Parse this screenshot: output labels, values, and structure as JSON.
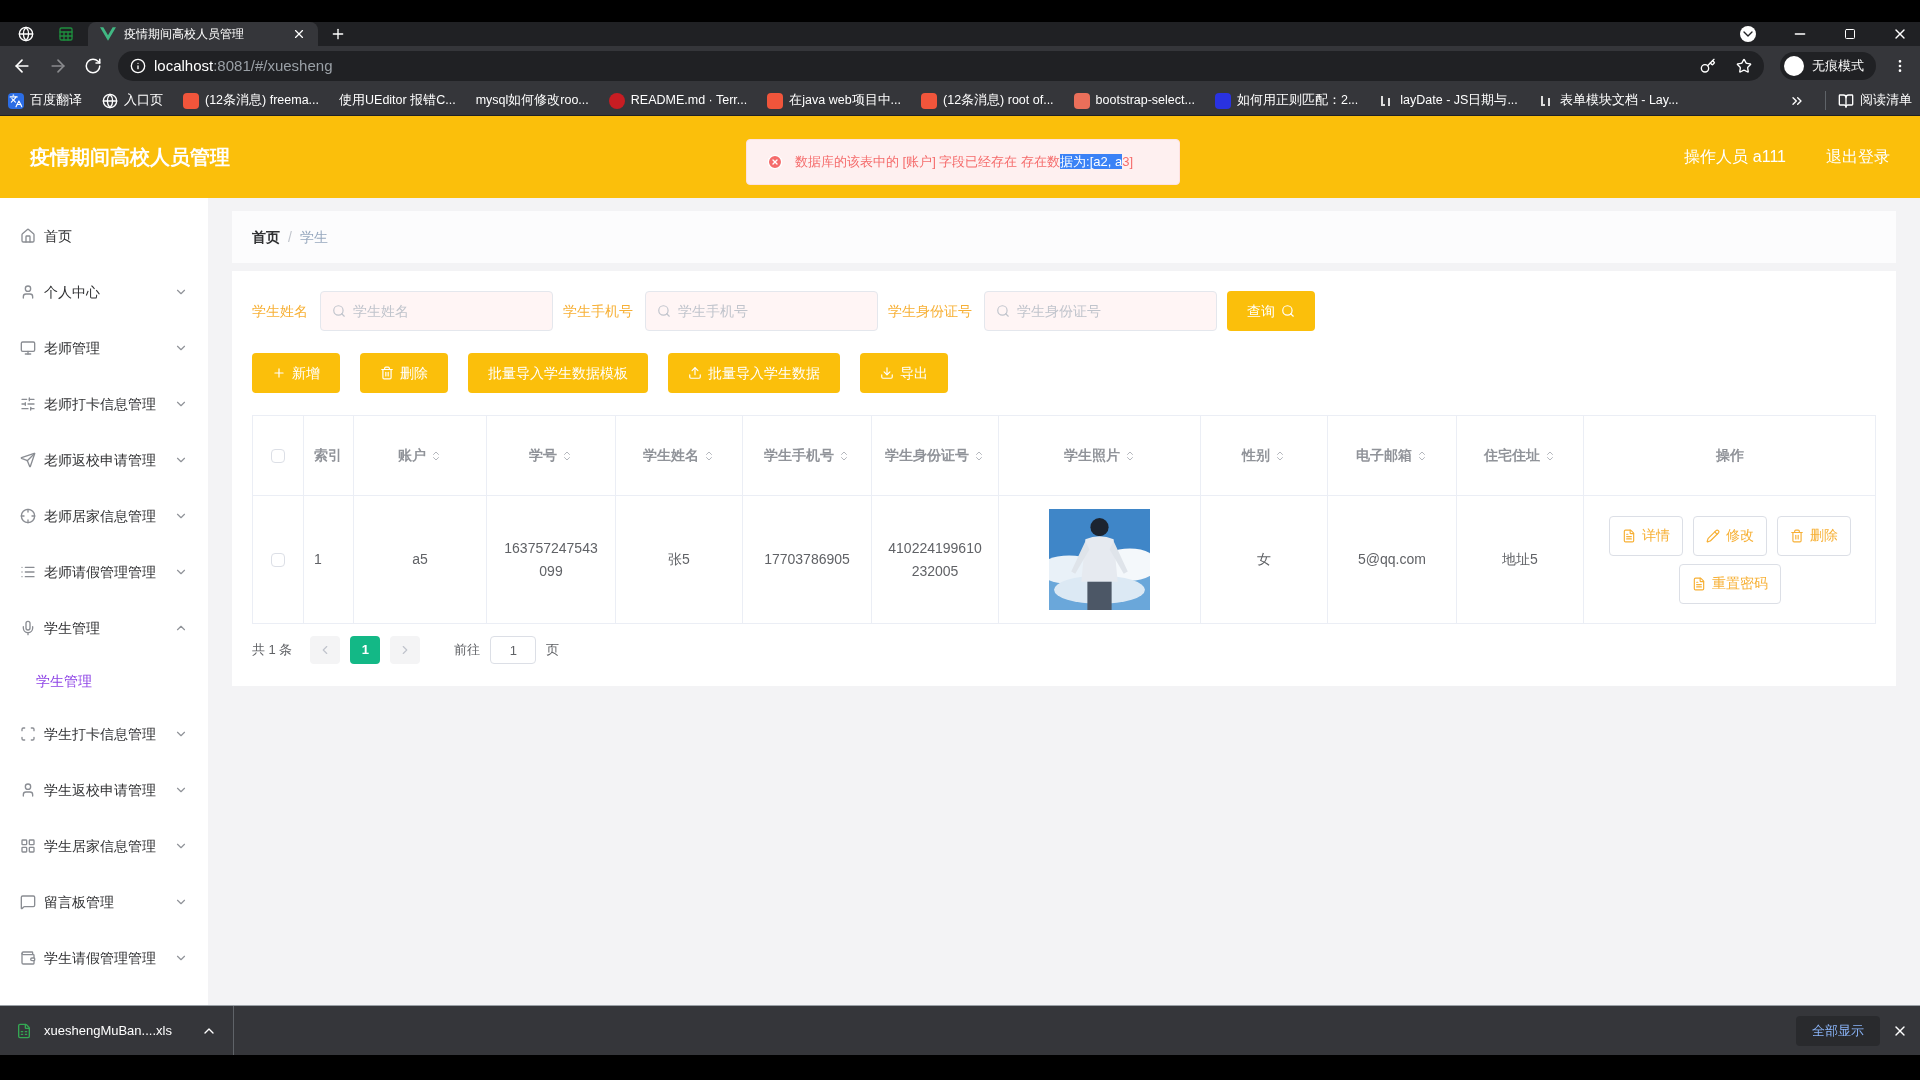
{
  "browser": {
    "tabs": [
      {
        "kind": "globe",
        "selected": false
      },
      {
        "kind": "sheet",
        "selected": false
      },
      {
        "kind": "vue",
        "title": "疫情期间高校人员管理",
        "selected": true
      }
    ],
    "url_host": "localhost",
    "url_rest": ":8081/#/xuesheng",
    "profile": "无痕模式",
    "bookmarks": [
      {
        "kind": "translate",
        "label": "百度翻译"
      },
      {
        "kind": "globe",
        "label": "入口页"
      },
      {
        "kind": "csdn",
        "label": "(12条消息) freema..."
      },
      {
        "kind": "none",
        "label": "使用UEditor 报错C..."
      },
      {
        "kind": "none",
        "label": "mysql如何修改roo..."
      },
      {
        "kind": "gitee",
        "label": "README.md · Terr..."
      },
      {
        "kind": "csdn",
        "label": "在java web项目中..."
      },
      {
        "kind": "csdn",
        "label": "(12条消息) root of..."
      },
      {
        "kind": "jianshu",
        "label": "bootstrap-select..."
      },
      {
        "kind": "baidu",
        "label": "如何用正则匹配：2..."
      },
      {
        "kind": "layui",
        "label": "layDate - JS日期与..."
      },
      {
        "kind": "layui",
        "label": "表单模块文档 - Lay..."
      }
    ],
    "reading_list": "阅读清单"
  },
  "header": {
    "title": "疫情期间高校人员管理",
    "operator": "操作人员 a111",
    "logout": "退出登录"
  },
  "toast": {
    "parts": [
      {
        "text": "数据库的该表中的 [账户] 字段已经存在 存在数",
        "selected": false
      },
      {
        "text": "据为:[a2, a",
        "selected": true
      },
      {
        "text": "3]",
        "selected": false
      }
    ]
  },
  "sidebar": {
    "items": [
      {
        "kind": "home",
        "label": "首页"
      },
      {
        "kind": "user",
        "label": "个人中心",
        "expanded": false
      },
      {
        "kind": "monitor",
        "label": "老师管理",
        "expanded": false
      },
      {
        "kind": "sliders",
        "label": "老师打卡信息管理",
        "expanded": false
      },
      {
        "kind": "send",
        "label": "老师返校申请管理",
        "expanded": false
      },
      {
        "kind": "crosshair",
        "label": "老师居家信息管理",
        "expanded": false
      },
      {
        "kind": "list",
        "label": "老师请假管理管理",
        "expanded": false
      },
      {
        "kind": "mic",
        "label": "学生管理",
        "expanded": true,
        "children": [
          {
            "label": "学生管理",
            "selected": true
          }
        ]
      },
      {
        "kind": "scan",
        "label": "学生打卡信息管理",
        "expanded": false
      },
      {
        "kind": "user",
        "label": "学生返校申请管理",
        "expanded": false
      },
      {
        "kind": "grid",
        "label": "学生居家信息管理",
        "expanded": false
      },
      {
        "kind": "message",
        "label": "留言板管理",
        "expanded": false
      },
      {
        "kind": "wallet",
        "label": "学生请假管理管理",
        "expanded": false
      }
    ]
  },
  "breadcrumb": [
    "首页",
    "学生"
  ],
  "breadcrumb_separator": "/",
  "search": {
    "fields": [
      {
        "label": "学生姓名",
        "placeholder": "学生姓名"
      },
      {
        "label": "学生手机号",
        "placeholder": "学生手机号"
      },
      {
        "label": "学生身份证号",
        "placeholder": "学生身份证号"
      }
    ],
    "button": "查询"
  },
  "actions": [
    {
      "kind": "plus",
      "label": "新增"
    },
    {
      "kind": "trash",
      "label": "删除"
    },
    {
      "kind": "none",
      "label": "批量导入学生数据模板"
    },
    {
      "kind": "upload",
      "label": "批量导入学生数据"
    },
    {
      "kind": "download",
      "label": "导出"
    }
  ],
  "table": {
    "select_all_checked": false,
    "columns": [
      {
        "label": "索引",
        "sortable": false
      },
      {
        "label": "账户",
        "sortable": true
      },
      {
        "label": "学号",
        "sortable": true
      },
      {
        "label": "学生姓名",
        "sortable": true
      },
      {
        "label": "学生手机号",
        "sortable": true
      },
      {
        "label": "学生身份证号",
        "sortable": true
      },
      {
        "label": "学生照片",
        "sortable": true
      },
      {
        "label": "性别",
        "sortable": true
      },
      {
        "label": "电子邮箱",
        "sortable": true
      },
      {
        "label": "住宅住址",
        "sortable": true
      },
      {
        "label": "操作",
        "sortable": false
      }
    ],
    "rows": [
      {
        "checked": false,
        "cells": [
          "1",
          "a5",
          "163757247543099",
          "张5",
          "17703786905",
          "410224199610232005",
          {
            "kind": "picture"
          },
          "女",
          "5@qq.com",
          "地址5"
        ],
        "buttons": [
          {
            "kind": "detail",
            "label": "详情"
          },
          {
            "kind": "edit",
            "label": "修改"
          },
          {
            "kind": "delete",
            "label": "删除"
          },
          {
            "kind": "reset",
            "label": "重置密码"
          }
        ]
      }
    ]
  },
  "pagination": {
    "total": "共 1 条",
    "pages": [
      {
        "label": "1",
        "selected": true
      }
    ],
    "goto": "前往",
    "page_input": "1",
    "page_unit": "页"
  },
  "downloads": {
    "file": "xueshengMuBan....xls",
    "show_all": "全部显示"
  }
}
